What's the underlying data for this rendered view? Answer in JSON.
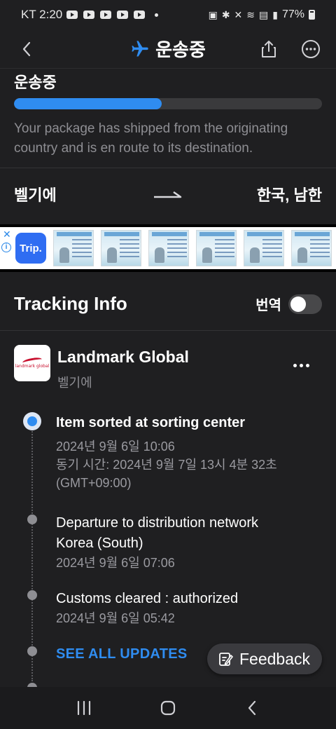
{
  "status_bar": {
    "carrier_time": "KT 2:20",
    "battery": "77%"
  },
  "app_bar": {
    "title": "운송중",
    "icons": [
      "back-icon",
      "airplane-icon",
      "share-icon",
      "more-icon"
    ]
  },
  "shipment_status": {
    "label": "운송중",
    "progress_percent": 48,
    "description": "Your package has shipped from the originating country and is en route to its destination."
  },
  "route": {
    "from": "벨기에",
    "to": "한국, 남한"
  },
  "ad": {
    "logo_text": "Trip.",
    "card_count": 6
  },
  "tracking": {
    "title": "Tracking Info",
    "translate_label": "번역",
    "translate_on": false
  },
  "carrier": {
    "name": "Landmark Global",
    "country": "벨기에",
    "logo_text": "landmark global"
  },
  "events": [
    {
      "title": "Item sorted at sorting center",
      "date": "2024년 9월 6일 10:06",
      "sync": "동기 시간: 2024년 9월 7일 13시 4분 32초",
      "tz": "(GMT+09:00)"
    },
    {
      "title_line1": "Departure to distribution network",
      "title_line2": "Korea (South)",
      "date": "2024년 9월 6일 07:06"
    },
    {
      "title": "Customs cleared : authorized",
      "date": "2024년 9월 6일 05:42"
    }
  ],
  "see_all": "SEE ALL UPDATES",
  "feedback": {
    "label": "Feedback"
  },
  "colors": {
    "background": "#1f1f21",
    "accent": "#2f8cf0",
    "muted_text": "#8e8e93"
  }
}
